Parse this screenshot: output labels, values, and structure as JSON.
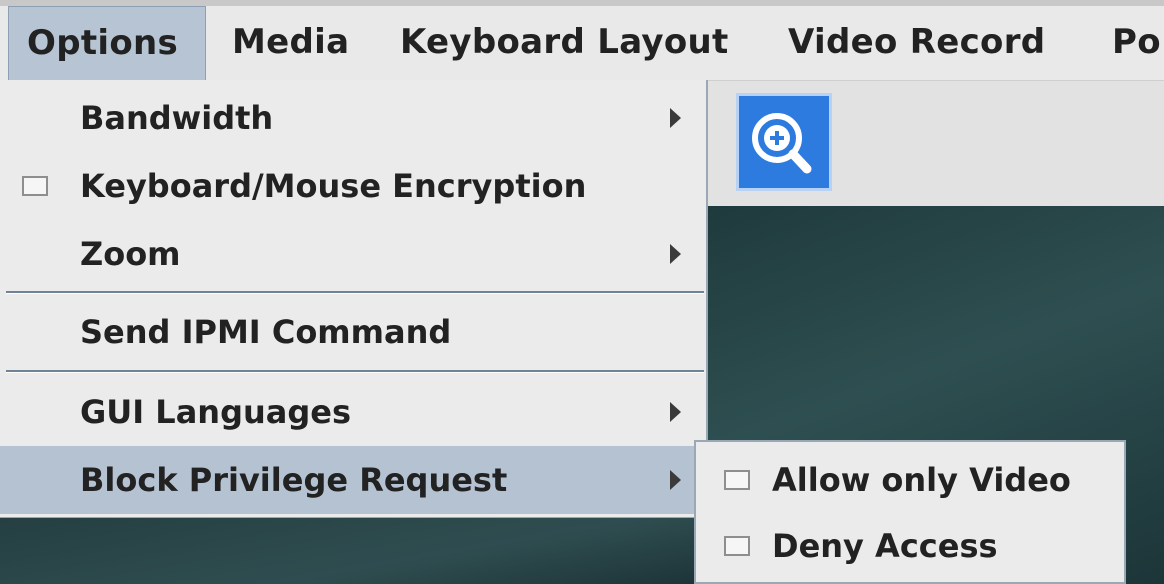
{
  "menubar": {
    "items": [
      {
        "label": "Options",
        "name": "options",
        "active": true
      },
      {
        "label": "Media",
        "name": "media"
      },
      {
        "label": "Keyboard Layout",
        "name": "keyboard-layout"
      },
      {
        "label": "Video Record",
        "name": "video-record"
      },
      {
        "label": "Po",
        "name": "power"
      }
    ]
  },
  "toolbar": {
    "zoom_icon": "zoom-in-icon"
  },
  "options_menu": {
    "items": [
      {
        "label": "Bandwidth",
        "has_submenu": true,
        "checkbox": false
      },
      {
        "label": "Keyboard/Mouse Encryption",
        "has_submenu": false,
        "checkbox": true,
        "checked": false
      },
      {
        "label": "Zoom",
        "has_submenu": true,
        "checkbox": false
      },
      {
        "label": "Send IPMI Command",
        "has_submenu": false,
        "checkbox": false
      },
      {
        "label": "GUI Languages",
        "has_submenu": true,
        "checkbox": false
      },
      {
        "label": "Block Privilege Request",
        "has_submenu": true,
        "checkbox": false,
        "highlighted": true
      }
    ]
  },
  "block_privilege_submenu": {
    "items": [
      {
        "label": "Allow only Video",
        "checked": false
      },
      {
        "label": "Deny Access",
        "checked": false
      }
    ]
  },
  "colors": {
    "menu_bg": "#ebebeb",
    "highlight": "#b4c2d2",
    "zoom_button": "#2e7be0",
    "desktop": "#2a4749"
  }
}
